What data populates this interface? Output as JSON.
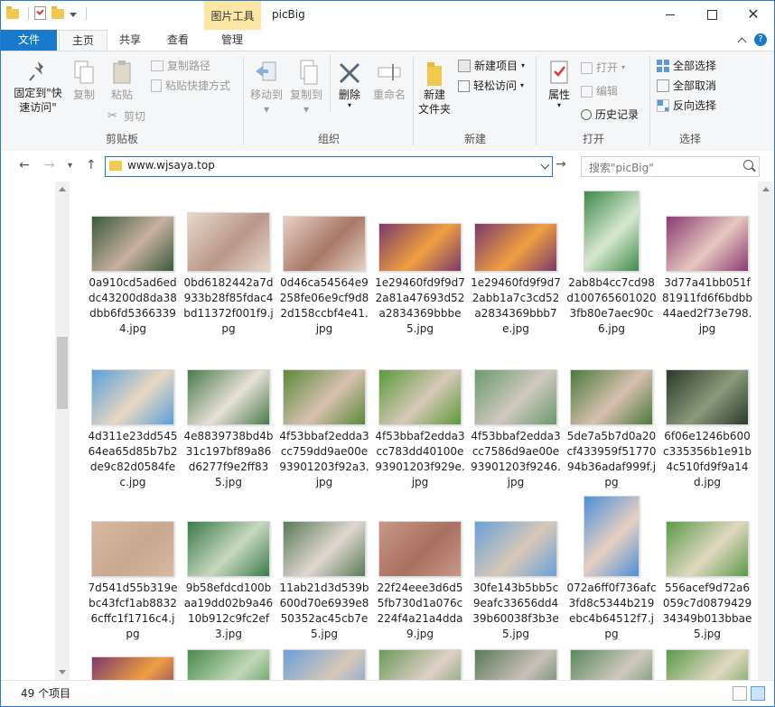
{
  "window": {
    "title": "picBig",
    "context_tab": "图片工具"
  },
  "ribbon_tabs": [
    {
      "label": "文件"
    },
    {
      "label": "主页"
    },
    {
      "label": "共享"
    },
    {
      "label": "查看"
    },
    {
      "label": "管理"
    }
  ],
  "ribbon": {
    "clipboard": {
      "pin": "固定到\"快速访问\"",
      "copy": "复制",
      "paste": "粘贴",
      "copy_path": "复制路径",
      "paste_shortcut": "粘贴快捷方式",
      "cut": "剪切",
      "label": "剪贴板"
    },
    "organize": {
      "move_to": "移动到",
      "copy_to": "复制到",
      "delete": "删除",
      "rename": "重命名",
      "label": "组织"
    },
    "new": {
      "new_folder": "新建\n文件夹",
      "new_item": "新建项目",
      "easy_access": "轻松访问",
      "label": "新建"
    },
    "open": {
      "properties": "属性",
      "open": "打开",
      "edit": "编辑",
      "history": "历史记录",
      "label": "打开"
    },
    "select": {
      "select_all": "全部选择",
      "select_none": "全部取消",
      "invert": "反向选择",
      "label": "选择"
    }
  },
  "address": {
    "path": "www.wjsaya.top",
    "search_placeholder": "搜索\"picBig\""
  },
  "files": [
    {
      "name": "0a910cd5ad6eddc43200d8da38dbb6fd53663394.jpg",
      "c1": "#3a5a3a",
      "c2": "#c9b0a0",
      "w": 90,
      "h": 60
    },
    {
      "name": "0bd6182442a7d933b28f85fdac4bd11372f001f9.jpg",
      "c1": "#e8d8cc",
      "c2": "#b89888",
      "w": 90,
      "h": 64
    },
    {
      "name": "0d46ca54564e9258fe06e9cf9d82d158ccbf4e41.jpg",
      "c1": "#e6d2c4",
      "c2": "#a87868",
      "w": 90,
      "h": 60
    },
    {
      "name": "1e29460fd9f9d72a81a47693d52a2834369bbbe5.jpg",
      "c1": "#7a3a6a",
      "c2": "#f0a040",
      "w": 90,
      "h": 52
    },
    {
      "name": "1e29460fd9f9d72abb1a7c3cd52a2834369bbb7e.jpg",
      "c1": "#7a3a6a",
      "c2": "#f0a040",
      "w": 90,
      "h": 52
    },
    {
      "name": "2ab8b4cc7cd98d1007656010203fb80e7aec90c6.jpg",
      "c1": "#3f8a4a",
      "c2": "#d8e8d0",
      "w": 60,
      "h": 88
    },
    {
      "name": "3d77a41bb051f81911fd6f6bdbb44aed2f73e798.jpg",
      "c1": "#8a3a70",
      "c2": "#e6c8c0",
      "w": 90,
      "h": 60
    },
    {
      "name": "4d311e23dd54564ea65d85b7b2de9c82d0584fec.jpg",
      "c1": "#5aa0d8",
      "c2": "#e8d8c0",
      "w": 90,
      "h": 60
    },
    {
      "name": "4e8839738bd4b31c197bf89a86d6277f9e2ff835.jpg",
      "c1": "#4a7a4a",
      "c2": "#e8e0d8",
      "w": 90,
      "h": 60
    },
    {
      "name": "4f53bbaf2edda3cc759dd9ae00e93901203f92a3.jpg",
      "c1": "#5a8a3a",
      "c2": "#d8c0b0",
      "w": 90,
      "h": 60
    },
    {
      "name": "4f53bbaf2edda3cc783dd40100e93901203f929e.jpg",
      "c1": "#5a9a3a",
      "c2": "#d8c8b8",
      "w": 90,
      "h": 60
    },
    {
      "name": "4f53bbaf2edda3cc7586d9ae00e93901203f9246.jpg",
      "c1": "#6a9a6a",
      "c2": "#d0c8c0",
      "w": 90,
      "h": 60
    },
    {
      "name": "5de7a5b7d0a20cf433959f5177094b36adaf999f.jpg",
      "c1": "#4a7a3a",
      "c2": "#d8c0b0",
      "w": 90,
      "h": 60
    },
    {
      "name": "6f06e1246b600c335356b1e91b4c510fd9f9a14d.jpg",
      "c1": "#2a3a2a",
      "c2": "#8a9a7a",
      "w": 90,
      "h": 60
    },
    {
      "name": "7d541d55b319ebc43fcf1ab88326cffc1f1716c4.jpg",
      "c1": "#d8b8a0",
      "c2": "#c8a890",
      "w": 90,
      "h": 60
    },
    {
      "name": "9b58efdcd100baa19dd02b9a4610b912c9fc2ef3.jpg",
      "c1": "#3a7a4a",
      "c2": "#c8d8c0",
      "w": 90,
      "h": 60
    },
    {
      "name": "11ab21d3d539b600d70e6939e850352ac45cb7e5.jpg",
      "c1": "#5a7a5a",
      "c2": "#e0d8d0",
      "w": 90,
      "h": 60
    },
    {
      "name": "22f24eee3d6d55fb730d1a076c224f4a21a4dda9.jpg",
      "c1": "#c89888",
      "c2": "#a87060",
      "w": 90,
      "h": 60
    },
    {
      "name": "30fe143b5bb5c9eafc33656dd439b60038f3b3e5.jpg",
      "c1": "#6aa0d8",
      "c2": "#d8c8b8",
      "w": 90,
      "h": 60
    },
    {
      "name": "072a6ff0f736afc3fd8c5344b219ebc4b64512f7.jpg",
      "c1": "#4a90d8",
      "c2": "#e8d0c0",
      "w": 60,
      "h": 88
    },
    {
      "name": "556acef9d72a6059c7d087942934349b013bbae5.jpg",
      "c1": "#5a9a4a",
      "c2": "#e0d8c0",
      "w": 90,
      "h": 60
    },
    {
      "name": "",
      "c1": "#7a3a6a",
      "c2": "#f0a040",
      "w": 90,
      "h": 52
    },
    {
      "name": "",
      "c1": "#4a8a4a",
      "c2": "#c0d8b8",
      "w": 90,
      "h": 60
    },
    {
      "name": "",
      "c1": "#6aa0d8",
      "c2": "#d8c8b8",
      "w": 90,
      "h": 60
    },
    {
      "name": "",
      "c1": "#6a9a5a",
      "c2": "#e0d0c8",
      "w": 90,
      "h": 60
    },
    {
      "name": "",
      "c1": "#5a7a5a",
      "c2": "#c8c0b8",
      "w": 90,
      "h": 60
    },
    {
      "name": "",
      "c1": "#5a8a5a",
      "c2": "#d0c8c0",
      "w": 90,
      "h": 60
    },
    {
      "name": "",
      "c1": "#5a9a4a",
      "c2": "#e0d8c0",
      "w": 90,
      "h": 60
    }
  ],
  "status": {
    "count": "49 个项目"
  },
  "colors": {
    "accent": "#1979ca",
    "context_tab": "#fbe7a2",
    "ribbon_bg": "#f5f6f7"
  }
}
